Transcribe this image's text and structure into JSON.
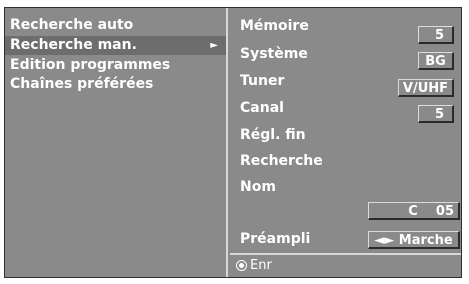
{
  "menu": {
    "items": [
      {
        "label": "Recherche auto"
      },
      {
        "label": "Recherche man.",
        "arrow": "►"
      },
      {
        "label": "Edition programmes"
      },
      {
        "label": "Chaînes préférées"
      }
    ]
  },
  "settings": {
    "memoire": {
      "label": "Mémoire",
      "value": "5"
    },
    "systeme": {
      "label": "Système",
      "value": "BG"
    },
    "tuner": {
      "label": "Tuner",
      "value": "V/UHF"
    },
    "canal": {
      "label": "Canal",
      "value": "5"
    },
    "regl_fin": {
      "label": "Régl. fin"
    },
    "recherche": {
      "label": "Recherche"
    },
    "nom": {
      "label": "Nom",
      "value": "C    05"
    },
    "preampli": {
      "label": "Préampli",
      "value": "◄► Marche"
    }
  },
  "footer": {
    "icon": "record-icon",
    "label": "Enr"
  },
  "colors": {
    "panel": "#8a8a8a",
    "selected": "#6d6d6d",
    "text": "#ffffff"
  }
}
